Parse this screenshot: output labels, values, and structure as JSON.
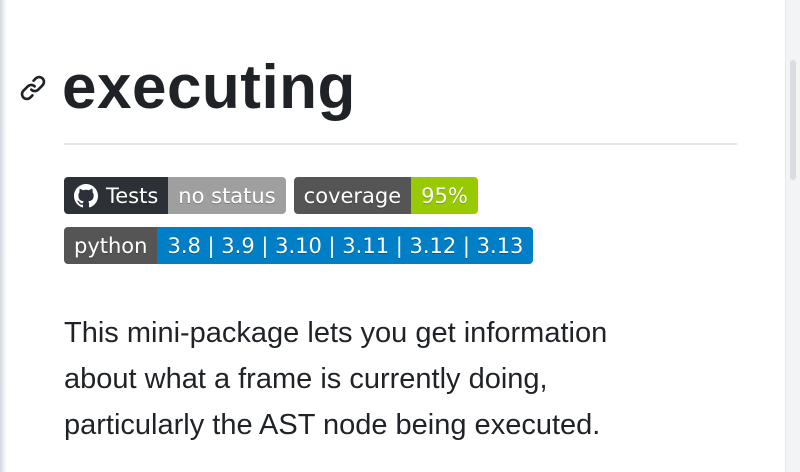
{
  "header": {
    "title": "executing"
  },
  "badges": {
    "tests": {
      "label": "Tests",
      "value": "no status",
      "icon": "github-icon"
    },
    "coverage": {
      "label": "coverage",
      "value": "95%",
      "value_color": "#97ca00"
    },
    "python": {
      "label": "python",
      "value": "3.8 | 3.9 | 3.10 | 3.11 | 3.12 | 3.13",
      "value_color": "#007ec6"
    }
  },
  "description": {
    "lines": [
      "This mini-package lets you get information",
      "about what a frame is currently doing,",
      "particularly the AST node being executed."
    ]
  }
}
